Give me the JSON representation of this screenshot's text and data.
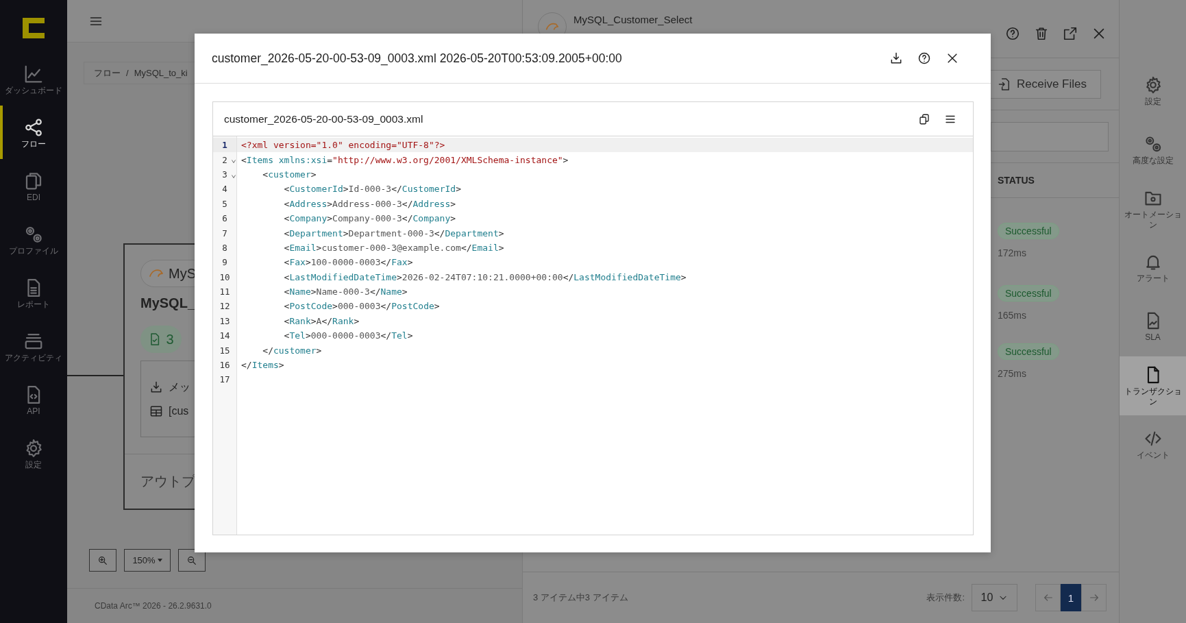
{
  "nav": {
    "items": [
      {
        "label": "ダッシュボード",
        "selected": false
      },
      {
        "label": "フロー",
        "selected": true
      },
      {
        "label": "EDI",
        "selected": false
      },
      {
        "label": "プロファイル",
        "selected": false
      },
      {
        "label": "レポート",
        "selected": false
      },
      {
        "label": "アクティビティ",
        "selected": false
      },
      {
        "label": "API",
        "selected": false
      },
      {
        "label": "設定",
        "selected": false
      }
    ]
  },
  "canvas": {
    "breadcrumb": [
      "フロー",
      "/",
      "MySQL_to_ki"
    ],
    "node": {
      "connector": "MyS",
      "title": "MySQL_",
      "count": "3",
      "lines": [
        "メッ",
        "[cus"
      ],
      "footer": "アウトプ"
    },
    "zoom": "150%"
  },
  "footer": "CData Arc™ 2026 - 26.2.9631.0",
  "panel": {
    "title": "MySQL_Customer_Select",
    "receive_button": "Receive Files",
    "status_header": "STATUS",
    "rows": [
      {
        "status": "Successful",
        "time": "172ms"
      },
      {
        "status": "Successful",
        "time": "165ms"
      },
      {
        "status": "Successful",
        "time": "275ms"
      }
    ],
    "summary": "3 アイテム中3 アイテム",
    "page_size_label": "表示件数:",
    "page_size": "10",
    "pages": [
      {
        "label": "1",
        "selected": true
      }
    ]
  },
  "rail": {
    "items": [
      {
        "label": "設定",
        "selected": false
      },
      {
        "label": "高度な設定",
        "selected": false
      },
      {
        "label": "オートメーション",
        "selected": false
      },
      {
        "label": "アラート",
        "selected": false
      },
      {
        "label": "SLA",
        "selected": false
      },
      {
        "label": "トランザクション",
        "selected": true
      },
      {
        "label": "イベント",
        "selected": false
      }
    ]
  },
  "modal": {
    "title": "customer_2026-05-20-00-53-09_0003.xml 2026-05-20T00:53:09.2005+00:00",
    "file_name": "customer_2026-05-20-00-53-09_0003.xml",
    "lines": [
      {
        "number": "1",
        "selected": true,
        "foldable": false,
        "tokens": [
          {
            "kind": "decl",
            "text": "<?xml version=\"1.0\" encoding=\"UTF-8\"?>"
          }
        ]
      },
      {
        "number": "2",
        "selected": false,
        "foldable": true,
        "tokens": [
          {
            "kind": "punct",
            "text": "<"
          },
          {
            "kind": "tag",
            "text": "Items xmlns:xsi"
          },
          {
            "kind": "punct",
            "text": "="
          },
          {
            "kind": "string",
            "text": "\"http://www.w3.org/2001/XMLSchema-instance\""
          },
          {
            "kind": "punct",
            "text": ">"
          }
        ]
      },
      {
        "number": "3",
        "selected": false,
        "foldable": true,
        "tokens": [
          {
            "kind": "punct",
            "text": "    <"
          },
          {
            "kind": "tag",
            "text": "customer"
          },
          {
            "kind": "punct",
            "text": ">"
          }
        ]
      },
      {
        "number": "4",
        "selected": false,
        "foldable": false,
        "tokens": [
          {
            "kind": "punct",
            "text": "        <"
          },
          {
            "kind": "tag",
            "text": "CustomerId"
          },
          {
            "kind": "punct",
            "text": ">"
          },
          {
            "kind": "text",
            "text": "Id-000-3"
          },
          {
            "kind": "punct",
            "text": "</"
          },
          {
            "kind": "tag",
            "text": "CustomerId"
          },
          {
            "kind": "punct",
            "text": ">"
          }
        ]
      },
      {
        "number": "5",
        "selected": false,
        "foldable": false,
        "tokens": [
          {
            "kind": "punct",
            "text": "        <"
          },
          {
            "kind": "tag",
            "text": "Address"
          },
          {
            "kind": "punct",
            "text": ">"
          },
          {
            "kind": "text",
            "text": "Address-000-3"
          },
          {
            "kind": "punct",
            "text": "</"
          },
          {
            "kind": "tag",
            "text": "Address"
          },
          {
            "kind": "punct",
            "text": ">"
          }
        ]
      },
      {
        "number": "6",
        "selected": false,
        "foldable": false,
        "tokens": [
          {
            "kind": "punct",
            "text": "        <"
          },
          {
            "kind": "tag",
            "text": "Company"
          },
          {
            "kind": "punct",
            "text": ">"
          },
          {
            "kind": "text",
            "text": "Company-000-3"
          },
          {
            "kind": "punct",
            "text": "</"
          },
          {
            "kind": "tag",
            "text": "Company"
          },
          {
            "kind": "punct",
            "text": ">"
          }
        ]
      },
      {
        "number": "7",
        "selected": false,
        "foldable": false,
        "tokens": [
          {
            "kind": "punct",
            "text": "        <"
          },
          {
            "kind": "tag",
            "text": "Department"
          },
          {
            "kind": "punct",
            "text": ">"
          },
          {
            "kind": "text",
            "text": "Department-000-3"
          },
          {
            "kind": "punct",
            "text": "</"
          },
          {
            "kind": "tag",
            "text": "Department"
          },
          {
            "kind": "punct",
            "text": ">"
          }
        ]
      },
      {
        "number": "8",
        "selected": false,
        "foldable": false,
        "tokens": [
          {
            "kind": "punct",
            "text": "        <"
          },
          {
            "kind": "tag",
            "text": "Email"
          },
          {
            "kind": "punct",
            "text": ">"
          },
          {
            "kind": "text",
            "text": "customer-000-3@example.com"
          },
          {
            "kind": "punct",
            "text": "</"
          },
          {
            "kind": "tag",
            "text": "Email"
          },
          {
            "kind": "punct",
            "text": ">"
          }
        ]
      },
      {
        "number": "9",
        "selected": false,
        "foldable": false,
        "tokens": [
          {
            "kind": "punct",
            "text": "        <"
          },
          {
            "kind": "tag",
            "text": "Fax"
          },
          {
            "kind": "punct",
            "text": ">"
          },
          {
            "kind": "text",
            "text": "100-0000-0003"
          },
          {
            "kind": "punct",
            "text": "</"
          },
          {
            "kind": "tag",
            "text": "Fax"
          },
          {
            "kind": "punct",
            "text": ">"
          }
        ]
      },
      {
        "number": "10",
        "selected": false,
        "foldable": false,
        "tokens": [
          {
            "kind": "punct",
            "text": "        <"
          },
          {
            "kind": "tag",
            "text": "LastModifiedDateTime"
          },
          {
            "kind": "punct",
            "text": ">"
          },
          {
            "kind": "text",
            "text": "2026-02-24T07:10:21.0000+00:00"
          },
          {
            "kind": "punct",
            "text": "</"
          },
          {
            "kind": "tag",
            "text": "LastModifiedDateTime"
          },
          {
            "kind": "punct",
            "text": ">"
          }
        ]
      },
      {
        "number": "11",
        "selected": false,
        "foldable": false,
        "tokens": [
          {
            "kind": "punct",
            "text": "        <"
          },
          {
            "kind": "tag",
            "text": "Name"
          },
          {
            "kind": "punct",
            "text": ">"
          },
          {
            "kind": "text",
            "text": "Name-000-3"
          },
          {
            "kind": "punct",
            "text": "</"
          },
          {
            "kind": "tag",
            "text": "Name"
          },
          {
            "kind": "punct",
            "text": ">"
          }
        ]
      },
      {
        "number": "12",
        "selected": false,
        "foldable": false,
        "tokens": [
          {
            "kind": "punct",
            "text": "        <"
          },
          {
            "kind": "tag",
            "text": "PostCode"
          },
          {
            "kind": "punct",
            "text": ">"
          },
          {
            "kind": "text",
            "text": "000-0003"
          },
          {
            "kind": "punct",
            "text": "</"
          },
          {
            "kind": "tag",
            "text": "PostCode"
          },
          {
            "kind": "punct",
            "text": ">"
          }
        ]
      },
      {
        "number": "13",
        "selected": false,
        "foldable": false,
        "tokens": [
          {
            "kind": "punct",
            "text": "        <"
          },
          {
            "kind": "tag",
            "text": "Rank"
          },
          {
            "kind": "punct",
            "text": ">"
          },
          {
            "kind": "text",
            "text": "A"
          },
          {
            "kind": "punct",
            "text": "</"
          },
          {
            "kind": "tag",
            "text": "Rank"
          },
          {
            "kind": "punct",
            "text": ">"
          }
        ]
      },
      {
        "number": "14",
        "selected": false,
        "foldable": false,
        "tokens": [
          {
            "kind": "punct",
            "text": "        <"
          },
          {
            "kind": "tag",
            "text": "Tel"
          },
          {
            "kind": "punct",
            "text": ">"
          },
          {
            "kind": "text",
            "text": "000-0000-0003"
          },
          {
            "kind": "punct",
            "text": "</"
          },
          {
            "kind": "tag",
            "text": "Tel"
          },
          {
            "kind": "punct",
            "text": ">"
          }
        ]
      },
      {
        "number": "15",
        "selected": false,
        "foldable": false,
        "tokens": [
          {
            "kind": "punct",
            "text": "    </"
          },
          {
            "kind": "tag",
            "text": "customer"
          },
          {
            "kind": "punct",
            "text": ">"
          }
        ]
      },
      {
        "number": "16",
        "selected": false,
        "foldable": false,
        "tokens": [
          {
            "kind": "punct",
            "text": "</"
          },
          {
            "kind": "tag",
            "text": "Items"
          },
          {
            "kind": "punct",
            "text": ">"
          }
        ]
      },
      {
        "number": "17",
        "selected": false,
        "foldable": false
      }
    ]
  }
}
